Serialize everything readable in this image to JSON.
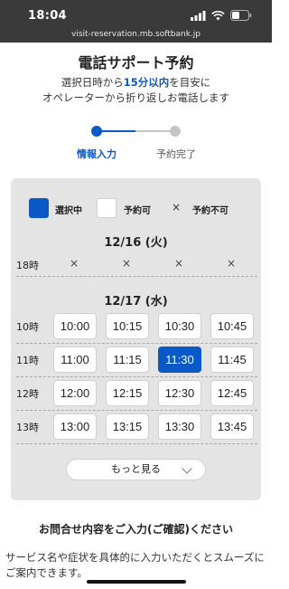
{
  "status_bar": {
    "time": "18:04"
  },
  "browser": {
    "url": "visit-reservation.mb.softbank.jp"
  },
  "header": {
    "title": "電話サポート予約",
    "subtitle_part1": "選択日時から",
    "subtitle_highlight": "15分以内",
    "subtitle_part2": "を目安に",
    "subtitle_line2": "オペレーターから折り返しお電話します"
  },
  "steps": [
    {
      "label": "情報入力",
      "active": true
    },
    {
      "label": "予約完了",
      "active": false
    }
  ],
  "legend": {
    "selected": "選択中",
    "available": "予約可",
    "unavailable_mark": "×",
    "unavailable": "予約不可"
  },
  "days": [
    {
      "date": "12/16 (火)",
      "rows": [
        {
          "hour": "18時",
          "slots": [
            "×",
            "×",
            "×",
            "×"
          ]
        }
      ]
    },
    {
      "date": "12/17 (水)",
      "rows": [
        {
          "hour": "10時",
          "slots": [
            "10:00",
            "10:15",
            "10:30",
            "10:45"
          ]
        },
        {
          "hour": "11時",
          "slots": [
            "11:00",
            "11:15",
            "11:30",
            "11:45"
          ]
        },
        {
          "hour": "12時",
          "slots": [
            "12:00",
            "12:15",
            "12:30",
            "12:45"
          ]
        },
        {
          "hour": "13時",
          "slots": [
            "13:00",
            "13:15",
            "13:30",
            "13:45"
          ]
        }
      ]
    }
  ],
  "selected_slot": "11:30",
  "more_button": "もっと見る",
  "inquiry": {
    "title": "お問合せ内容をご入力(ご確認)ください",
    "description": "サービス名や症状を具体的に入力いただくとスムーズにご案内できます。"
  },
  "colors": {
    "accent": "#0b58c7",
    "panel_bg": "#e4e4e4",
    "status_bar_bg": "#3a3a3a"
  }
}
